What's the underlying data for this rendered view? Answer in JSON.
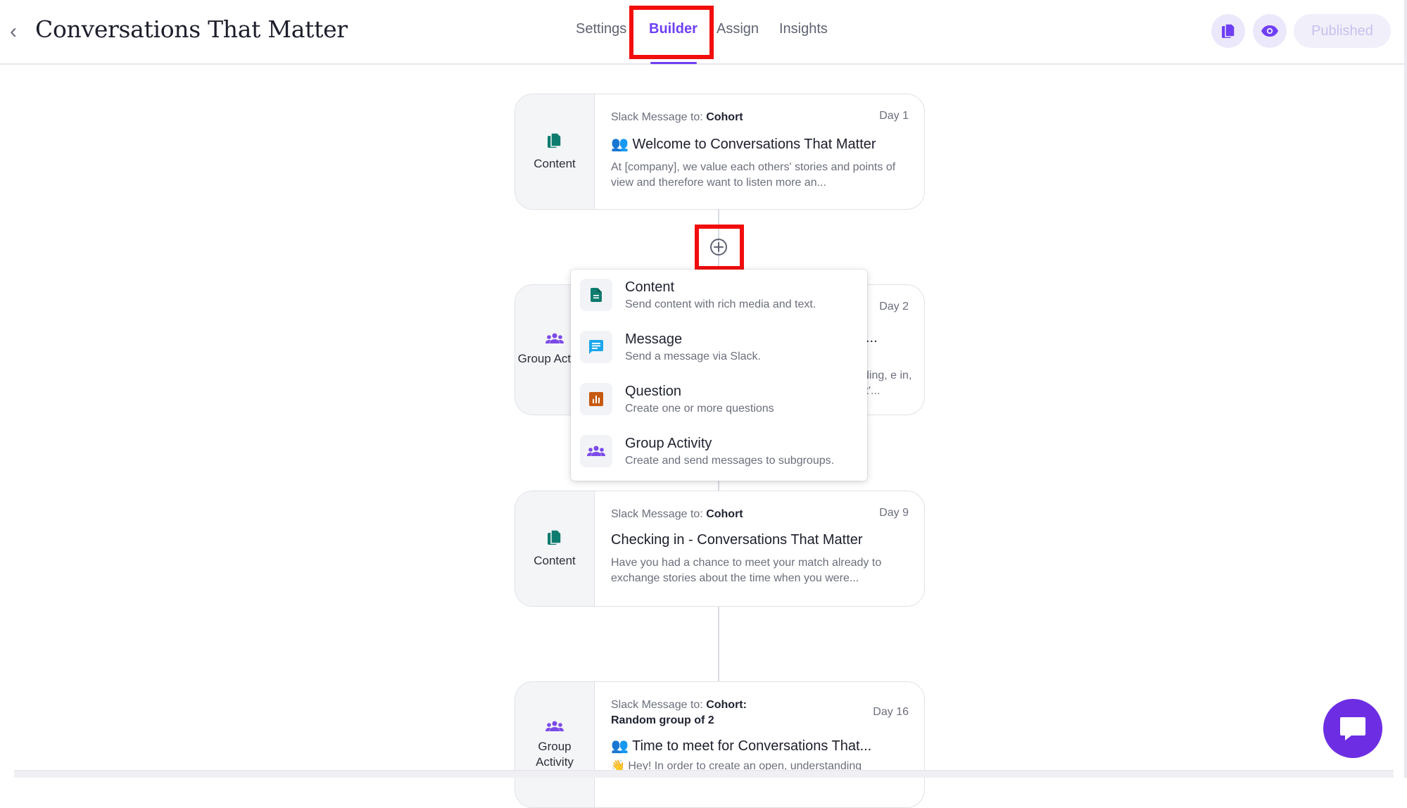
{
  "header": {
    "back_glyph": "‹",
    "title": "Conversations That Matter",
    "tabs": [
      {
        "label": "Settings"
      },
      {
        "label": "Builder",
        "active": true
      },
      {
        "label": "Assign"
      },
      {
        "label": "Insights"
      }
    ],
    "publish_label": "Published",
    "copy_icon": "copy-icon",
    "preview_icon": "eye-icon"
  },
  "cards": [
    {
      "type": "Content",
      "icon": "content-icon",
      "meta_prefix": "Slack Message to:",
      "meta_target": "Cohort",
      "day": "Day 1",
      "title": "👥 Welcome to Conversations That Matter",
      "desc": "At [company], we value each others' stories and points of view and therefore want to listen more an..."
    },
    {
      "type": "Group Activity",
      "icon": "group-icon",
      "day": "Day 2",
      "title_fragment": "...",
      "desc_fragment": "ding, e in, it'..."
    },
    {
      "type": "Content",
      "icon": "content-icon",
      "meta_prefix": "Slack Message to:",
      "meta_target": "Cohort",
      "day": "Day 9",
      "title": "Checking in - Conversations That Matter",
      "desc": "Have you had a chance to meet your match already to exchange stories about the time when you were..."
    },
    {
      "type": "Group Activity",
      "icon": "group-icon",
      "meta_prefix": "Slack Message to:",
      "meta_target": "Cohort: Random group of 2",
      "day": "Day 16",
      "title": "👥 Time to meet for Conversations That...",
      "desc": "👋 Hey! In order to create an open, understanding"
    }
  ],
  "add_menu": {
    "items": [
      {
        "label": "Content",
        "sub": "Send content with rich media and text.",
        "icon": "document-icon",
        "color": "#0e7c6e"
      },
      {
        "label": "Message",
        "sub": "Send a message via Slack.",
        "icon": "chat-bubble-icon",
        "color": "#1aa7ec"
      },
      {
        "label": "Question",
        "sub": "Create one or more questions",
        "icon": "bar-chart-icon",
        "color": "#c65a10"
      },
      {
        "label": "Group Activity",
        "sub": "Create and send messages to subgroups.",
        "icon": "group-icon",
        "color": "#7b4ae8"
      }
    ]
  },
  "colors": {
    "accent": "#6f3ff5",
    "highlight": "#f20d0d",
    "chat": "#6d2ee3"
  }
}
